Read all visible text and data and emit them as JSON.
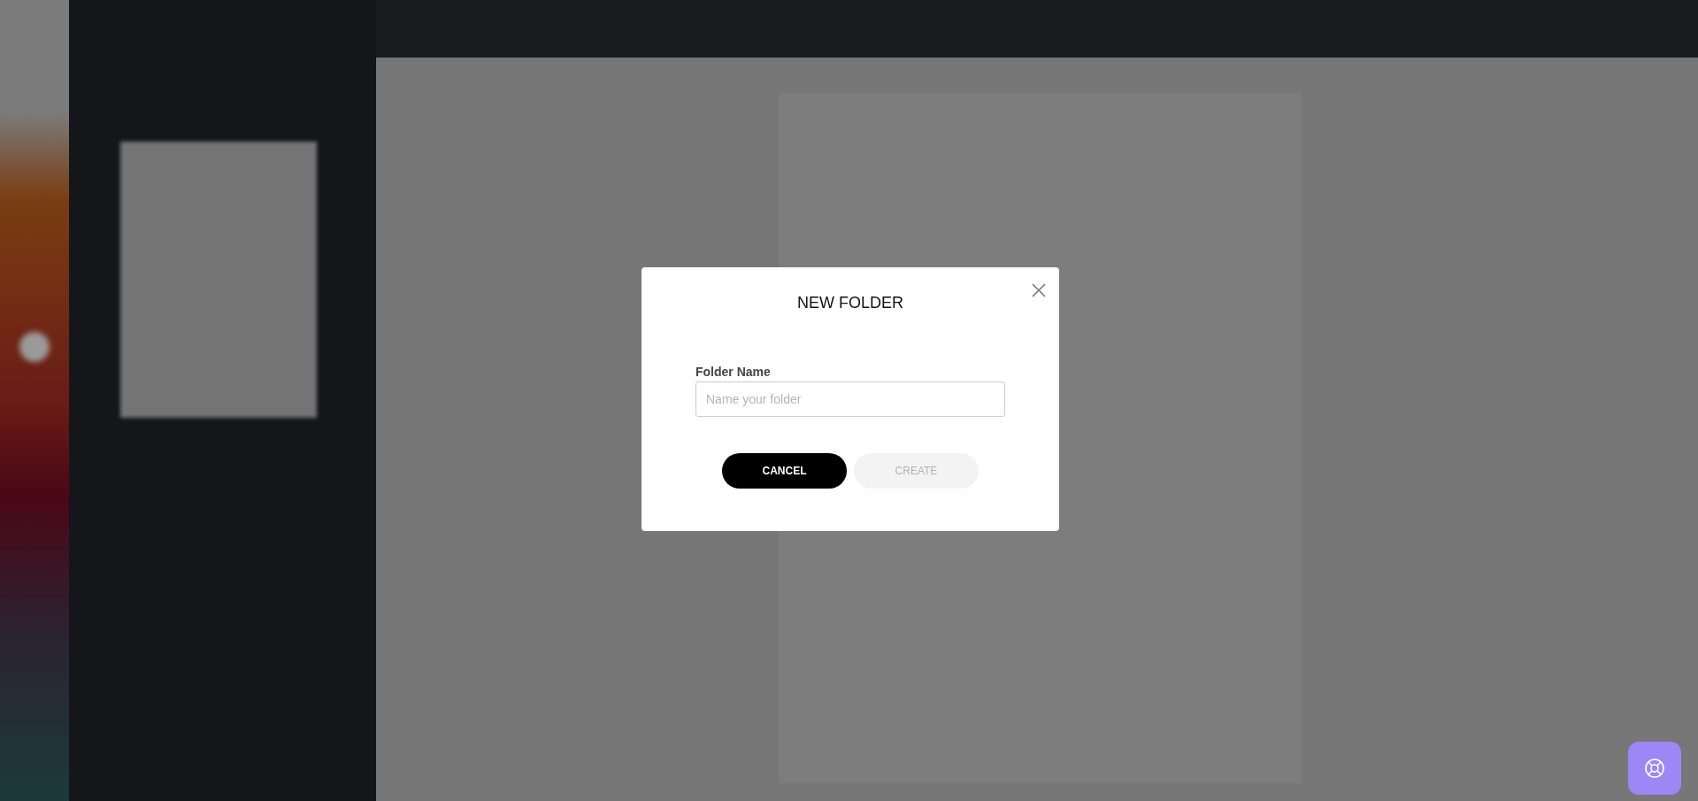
{
  "dialog": {
    "title": "NEW FOLDER",
    "field": {
      "label": "Folder Name",
      "placeholder": "Name your folder"
    },
    "buttons": [
      {
        "label": "CANCEL",
        "kind": "secondary",
        "disabled": false
      },
      {
        "label": "CREATE",
        "kind": "primary",
        "disabled": true
      }
    ]
  }
}
